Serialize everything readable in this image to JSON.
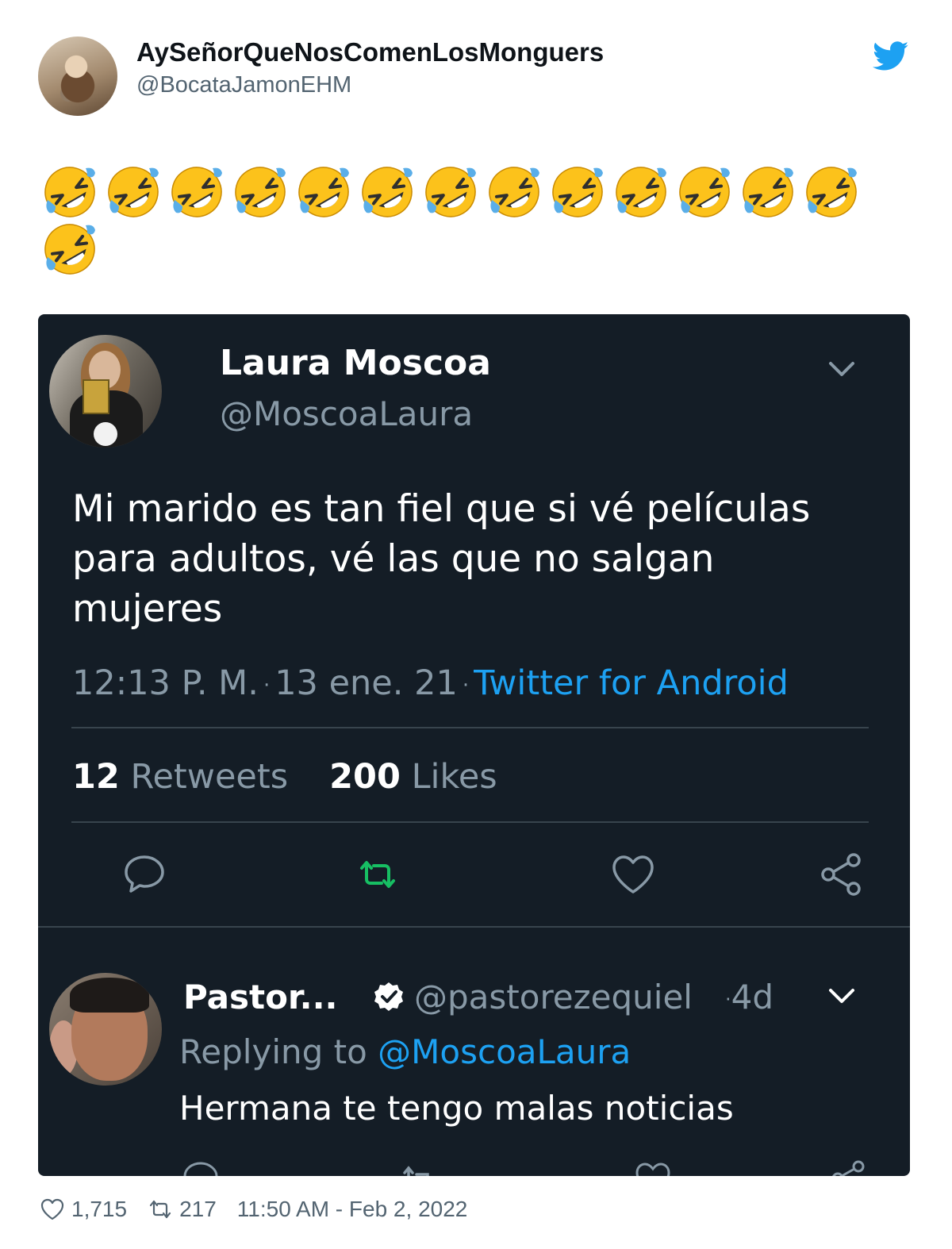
{
  "outer_tweet": {
    "display_name": "AySeñorQueNosComenLosMonguers",
    "handle": "@BocataJamonEHM",
    "emoji_name": "rolling-on-the-floor-laughing",
    "emoji_count": 14,
    "footer": {
      "likes": "1,715",
      "retweets": "217",
      "timestamp": "11:50 AM - Feb 2, 2022"
    }
  },
  "embedded_screenshot": {
    "main_tweet": {
      "display_name": "Laura Moscoa",
      "handle": "@MoscoaLaura",
      "text": "Mi marido es tan fiel que si vé películas para adultos, vé las que no salgan mujeres",
      "time": "12:13 P. M.",
      "date": "13 ene. 21",
      "client": "Twitter for Android",
      "retweet_count": "12",
      "retweet_label": "Retweets",
      "like_count": "200",
      "like_label": "Likes"
    },
    "reply_tweet": {
      "display_name": "Pastor...",
      "handle": "@pastorezequiel",
      "age": "4d",
      "replying_prefix": "Replying to",
      "replying_to": "@MoscoaLaura",
      "text": "Hermana te tengo malas noticias"
    }
  },
  "colors": {
    "twitter_blue": "#1da1f2",
    "dark_bg": "#141d26",
    "retweet_green": "#17bf63"
  }
}
